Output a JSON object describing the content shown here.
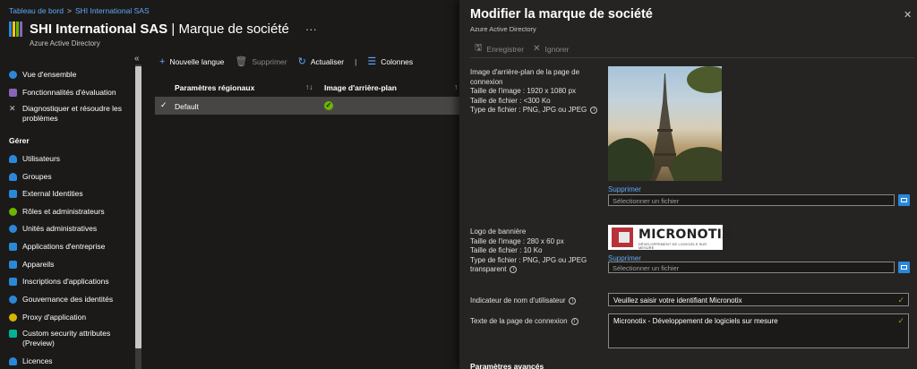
{
  "breadcrumb": {
    "home": "Tableau de bord",
    "sep": ">",
    "current": "SHI International SAS"
  },
  "header": {
    "title_org": "SHI International SAS",
    "title_sep": "|",
    "title_page": "Marque de société",
    "more": "···",
    "subtitle": "Azure Active Directory",
    "collapse": "«"
  },
  "sidebar": {
    "items_top": [
      {
        "label": "Vue d'ensemble",
        "color": "#2b88d8"
      },
      {
        "label": "Fonctionnalités d'évaluation",
        "color": "#8764b8"
      },
      {
        "label": "Diagnostiquer et résoudre les problèmes",
        "color": "#c8c6c4"
      }
    ],
    "section_manage": "Gérer",
    "items_manage": [
      {
        "label": "Utilisateurs",
        "color": "#2b88d8"
      },
      {
        "label": "Groupes",
        "color": "#2b88d8"
      },
      {
        "label": "External Identities",
        "color": "#2b88d8"
      },
      {
        "label": "Rôles et administrateurs",
        "color": "#6bb700"
      },
      {
        "label": "Unités administratives",
        "color": "#2b88d8"
      },
      {
        "label": "Applications d'entreprise",
        "color": "#2b88d8"
      },
      {
        "label": "Appareils",
        "color": "#2b88d8"
      },
      {
        "label": "Inscriptions d'applications",
        "color": "#2b88d8"
      },
      {
        "label": "Gouvernance des identités",
        "color": "#2b88d8"
      },
      {
        "label": "Proxy d'application",
        "color": "#d8b400"
      },
      {
        "label": "Custom security attributes (Preview)",
        "color": "#00b294"
      },
      {
        "label": "Licences",
        "color": "#2b88d8"
      }
    ]
  },
  "toolbar": {
    "new_language": "Nouvelle langue",
    "delete": "Supprimer",
    "refresh": "Actualiser",
    "columns": "Colonnes"
  },
  "grid": {
    "col_locale": "Paramètres régionaux",
    "col_bg": "Image d'arrière-plan",
    "sort_icon": "↑↓",
    "rows": [
      {
        "locale": "Default",
        "check": "✓",
        "bg_ok": "✓"
      }
    ]
  },
  "panel": {
    "title": "Modifier la marque de société",
    "subtitle": "Azure Active Directory",
    "close": "✕",
    "save": "Enregistrer",
    "discard": "Ignorer",
    "bg_label_1": "Image d'arrière-plan de la page de connexion",
    "bg_size": "Taille de l'image : 1920 x 1080 px",
    "bg_filesize": "Taille de fichier : <300 Ko",
    "bg_type": "Type de fichier : PNG, JPG ou JPEG",
    "bg_delete": "Supprimer",
    "bg_file_placeholder": "Sélectionner un fichier",
    "banner_label": "Logo de bannière",
    "banner_size": "Taille de l'image : 280 x 60 px",
    "banner_filesize": "Taille de fichier : 10 Ko",
    "banner_type": "Type de fichier : PNG, JPG ou JPEG transparent",
    "banner_logo_text": "MICRONOTIX",
    "banner_logo_tagline": "DÉVELOPPEMENT DE LOGICIELS SUR MESURE",
    "banner_delete": "Supprimer",
    "banner_file_placeholder": "Sélectionner un fichier",
    "username_hint_label": "Indicateur de nom d'utilisateur",
    "username_hint_value": "Veuillez saisir votre identifiant Micronotix",
    "signin_text_label": "Texte de la page de connexion",
    "signin_text_value": "Micronotix - Développement de logiciels sur mesure",
    "advanced": "Paramètres avancés",
    "info_glyph": "i",
    "valid_glyph": "✓"
  }
}
